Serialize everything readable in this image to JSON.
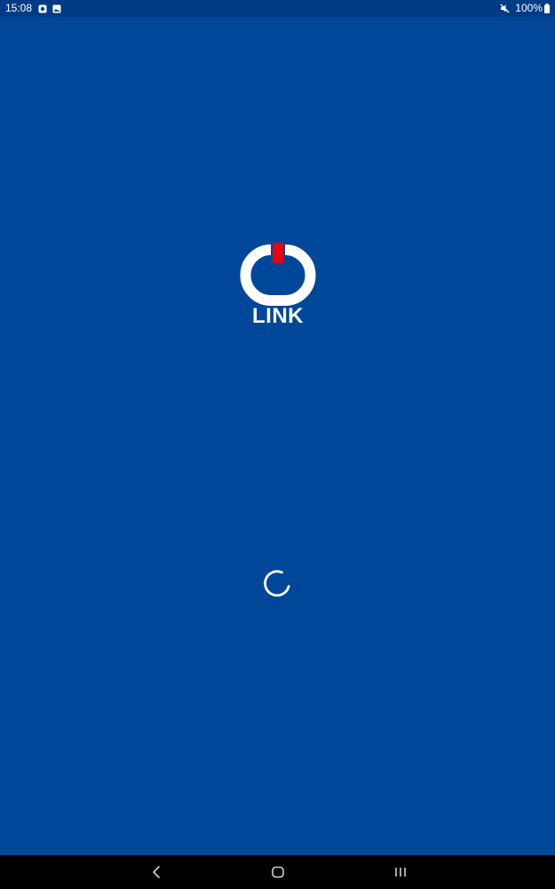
{
  "status_bar": {
    "time": "15:08",
    "notification_icons": [
      "record-icon",
      "image-icon"
    ],
    "battery": "100%",
    "system_icons": [
      "mute-icon",
      "battery-icon"
    ]
  },
  "splash": {
    "logo_text": "LINK",
    "logo_icon": "power-ring-logo",
    "accent_color": "#e30613",
    "background_color": "#00479a"
  },
  "loading": {
    "indicator": "spinner-icon"
  },
  "nav_bar": {
    "buttons": [
      "back-icon",
      "home-icon",
      "recents-icon"
    ]
  }
}
